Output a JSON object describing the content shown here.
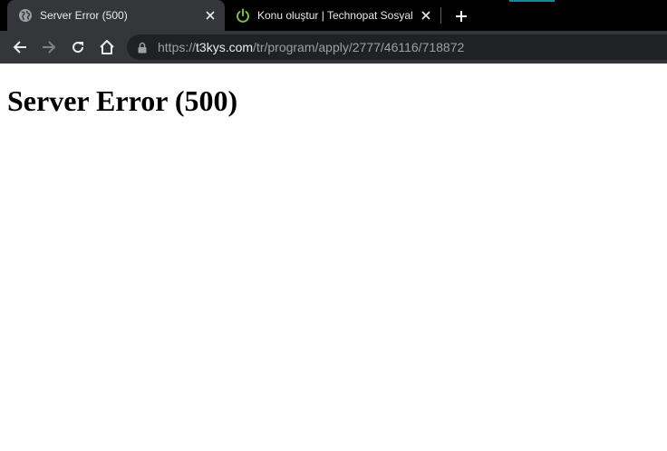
{
  "browser": {
    "tabs": [
      {
        "title": "Server Error (500)",
        "favicon": "globe-icon",
        "active": true
      },
      {
        "title": "Konu oluştur | Technopat Sosyal",
        "favicon": "power-icon",
        "active": false
      }
    ],
    "address_bar": {
      "scheme": "https://",
      "host": "t3kys.com",
      "path": "/tr/program/apply/2777/46116/718872"
    },
    "colors": {
      "tab_strip": "#000000",
      "active_tab": "#35363a",
      "toolbar": "#35363a",
      "omnibox": "#202124",
      "power_icon": "#7cc242"
    }
  },
  "page": {
    "heading": "Server Error (500)"
  }
}
